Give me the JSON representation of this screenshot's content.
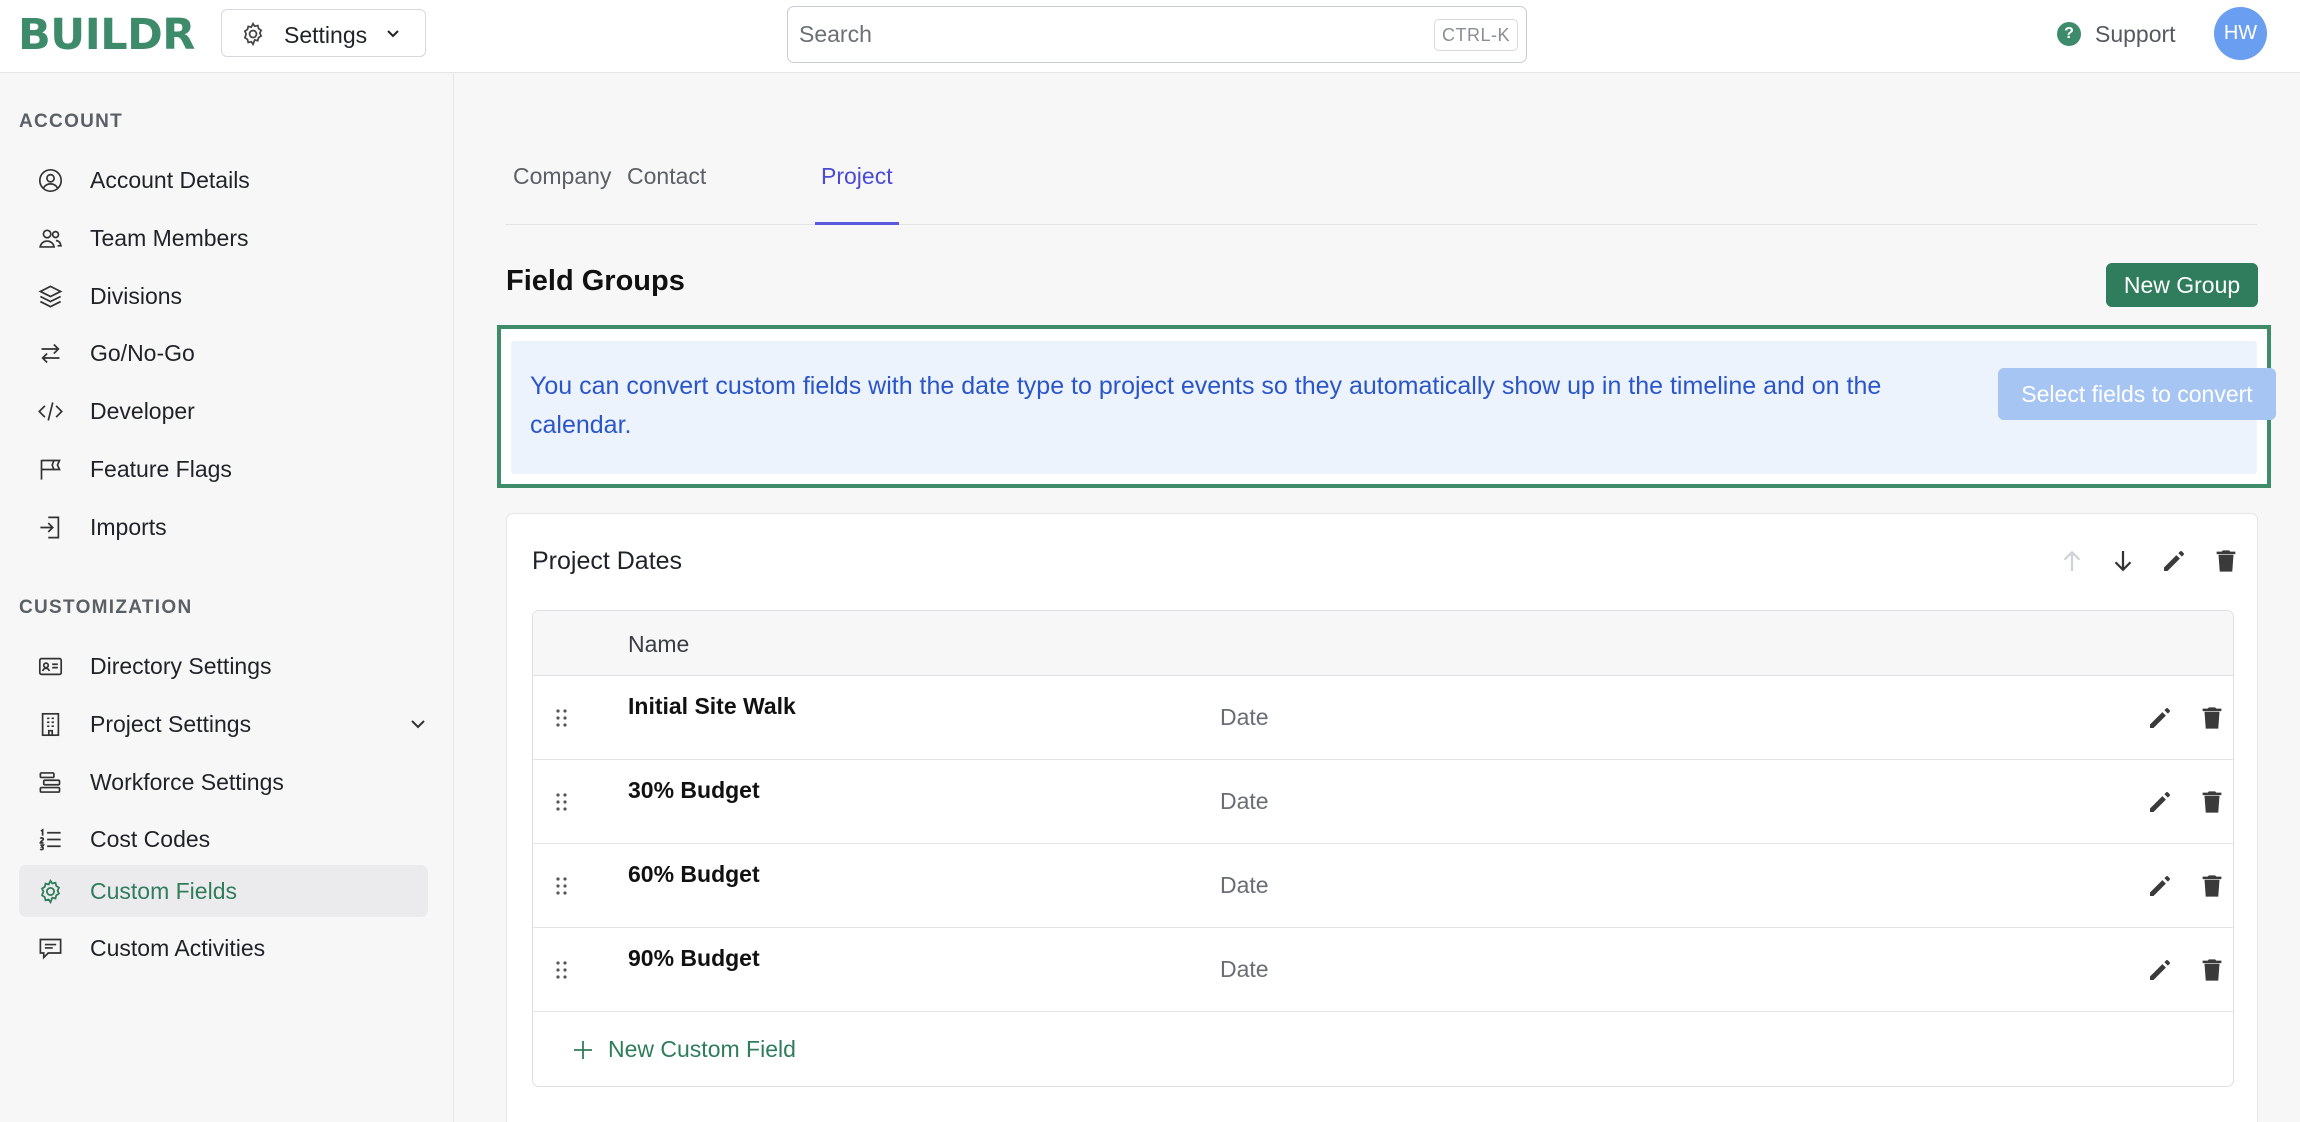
{
  "app": {
    "logo": "BUILDR"
  },
  "header": {
    "context_label": "Settings",
    "search_placeholder": "Search",
    "search_shortcut": "CTRL-K",
    "support_label": "Support",
    "avatar_initials": "HW"
  },
  "sidebar": {
    "sections": [
      {
        "title": "ACCOUNT",
        "items": [
          {
            "label": "Account Details",
            "icon": "user-circle-icon"
          },
          {
            "label": "Team Members",
            "icon": "users-icon"
          },
          {
            "label": "Divisions",
            "icon": "layers-icon"
          },
          {
            "label": "Go/No-Go",
            "icon": "arrows-swap-icon"
          },
          {
            "label": "Developer",
            "icon": "code-icon"
          },
          {
            "label": "Feature Flags",
            "icon": "flag-icon"
          },
          {
            "label": "Imports",
            "icon": "import-icon"
          }
        ]
      },
      {
        "title": "CUSTOMIZATION",
        "items": [
          {
            "label": "Directory Settings",
            "icon": "id-card-icon"
          },
          {
            "label": "Project Settings",
            "icon": "building-icon"
          },
          {
            "label": "Workforce Settings",
            "icon": "workforce-icon"
          },
          {
            "label": "Cost Codes",
            "icon": "list-numbered-icon"
          },
          {
            "label": "Custom Fields",
            "icon": "gear-icon",
            "active": true
          },
          {
            "label": "Custom Activities",
            "icon": "chat-icon"
          }
        ]
      }
    ]
  },
  "main": {
    "tabs": [
      {
        "label": "Company"
      },
      {
        "label": "Contact"
      },
      {
        "label": "Project",
        "active": true
      }
    ],
    "section_title": "Field Groups",
    "new_group_label": "New Group",
    "notice": {
      "message": "You can convert custom fields with the date type to project events so they automatically show up in the timeline and on the calendar.",
      "button_label": "Select fields to convert"
    },
    "group": {
      "title": "Project Dates",
      "column_name": "Name",
      "fields": [
        {
          "name": "Initial Site Walk",
          "type": "Date"
        },
        {
          "name": "30% Budget",
          "type": "Date"
        },
        {
          "name": "60% Budget",
          "type": "Date"
        },
        {
          "name": "90% Budget",
          "type": "Date"
        }
      ],
      "new_field_label": "New Custom Field"
    }
  },
  "colors": {
    "brand": "#3d8b6a",
    "tab_active": "#4a4ad6",
    "notice_bg": "#ecf3fd",
    "notice_text": "#2b56c9",
    "highlight_border": "#3f8c6b"
  }
}
